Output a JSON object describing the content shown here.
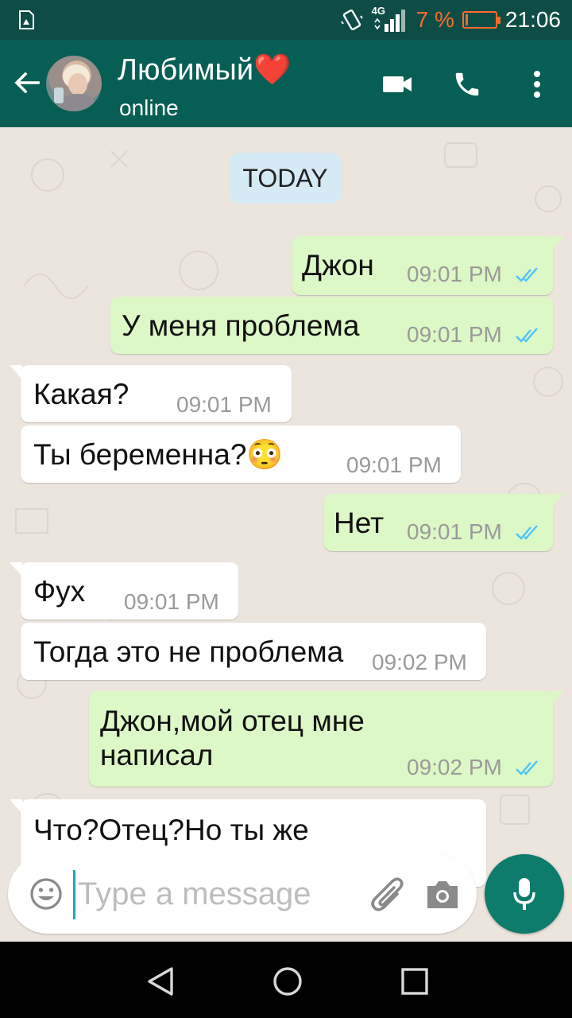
{
  "status_bar": {
    "network": "4G",
    "battery_percent": "7 %",
    "battery_level": 0.07,
    "time": "21:06"
  },
  "header": {
    "back_icon": "arrow-left-icon",
    "contact_name": "Любимый❤️",
    "status": "online",
    "actions": [
      "video-call-icon",
      "phone-call-icon",
      "more-vert-icon"
    ]
  },
  "chat": {
    "day_label": "TODAY",
    "messages": [
      {
        "direction": "out",
        "text": "Джон",
        "time": "09:01 PM",
        "read": true
      },
      {
        "direction": "out",
        "text": "У меня проблема",
        "time": "09:01 PM",
        "read": true
      },
      {
        "direction": "in",
        "text": "Какая?",
        "time": "09:01 PM"
      },
      {
        "direction": "in",
        "text": "Ты беременна?😳",
        "time": "09:01 PM"
      },
      {
        "direction": "out",
        "text": "Нет",
        "time": "09:01 PM",
        "read": true
      },
      {
        "direction": "in",
        "text": "Фух",
        "time": "09:01 PM"
      },
      {
        "direction": "in",
        "text": "Тогда это не проблема",
        "time": "09:02 PM"
      },
      {
        "direction": "out",
        "text": "Джон,мой отец мне написал",
        "time": "09:02 PM",
        "read": true
      },
      {
        "direction": "in",
        "text": "Что?Отец?Но ты же",
        "time": ""
      }
    ]
  },
  "composer": {
    "placeholder": "Type a message",
    "value": "",
    "icons": [
      "emoji-icon",
      "attach-icon",
      "camera-icon",
      "mic-icon"
    ]
  },
  "colors": {
    "header": "#075e54",
    "status_bar": "#0d4d45",
    "outgoing_bubble": "#dcf8c6",
    "incoming_bubble": "#ffffff",
    "chat_background": "#ece5dd",
    "read_ticks": "#4fc3f7",
    "fab": "#0d7c6d",
    "battery": "#ff6a2a"
  }
}
